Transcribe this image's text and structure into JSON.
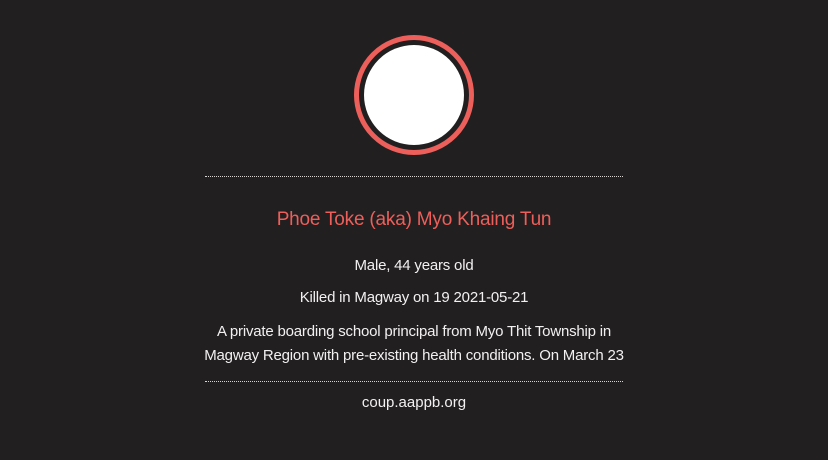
{
  "profile": {
    "name": "Phoe Toke (aka) Myo Khaing Tun",
    "gender_age": "Male, 44 years old",
    "killed": "Killed in Magway on 19 2021-05-21",
    "description": "A private boarding school principal from Myo Thit Township in Magway Region with pre-existing health conditions. On March 23",
    "source": "coup.aappb.org"
  },
  "colors": {
    "background": "#221f20",
    "accent": "#ec5f5a",
    "text": "#f2f0f0"
  }
}
